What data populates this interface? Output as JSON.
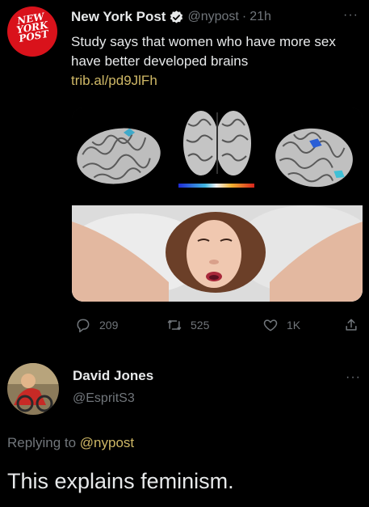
{
  "tweet": {
    "logo_lines": [
      "NEW",
      "YORK",
      "POST"
    ],
    "author_name": "New York Post",
    "handle": "@nypost",
    "separator": "·",
    "time": "21h",
    "more": "···",
    "text": "Study says that women who have more sex have better developed brains",
    "link": "trib.al/pd9JlFh",
    "stats": {
      "replies": "209",
      "retweets": "525",
      "likes": "1K"
    }
  },
  "reply": {
    "name": "David Jones",
    "handle": "@EspritS3",
    "more": "···",
    "replying_prefix": "Replying to",
    "replying_to": "@nypost",
    "text": "This explains feminism."
  },
  "icons": {
    "verified": "verified-badge-icon",
    "reply": "reply-icon",
    "retweet": "retweet-icon",
    "like": "heart-icon",
    "share": "share-icon",
    "more": "more-icon"
  },
  "colors": {
    "background": "#000000",
    "text": "#e7e9ea",
    "muted": "#71767b",
    "link": "#cfb866",
    "nyp_red": "#d9121b"
  }
}
